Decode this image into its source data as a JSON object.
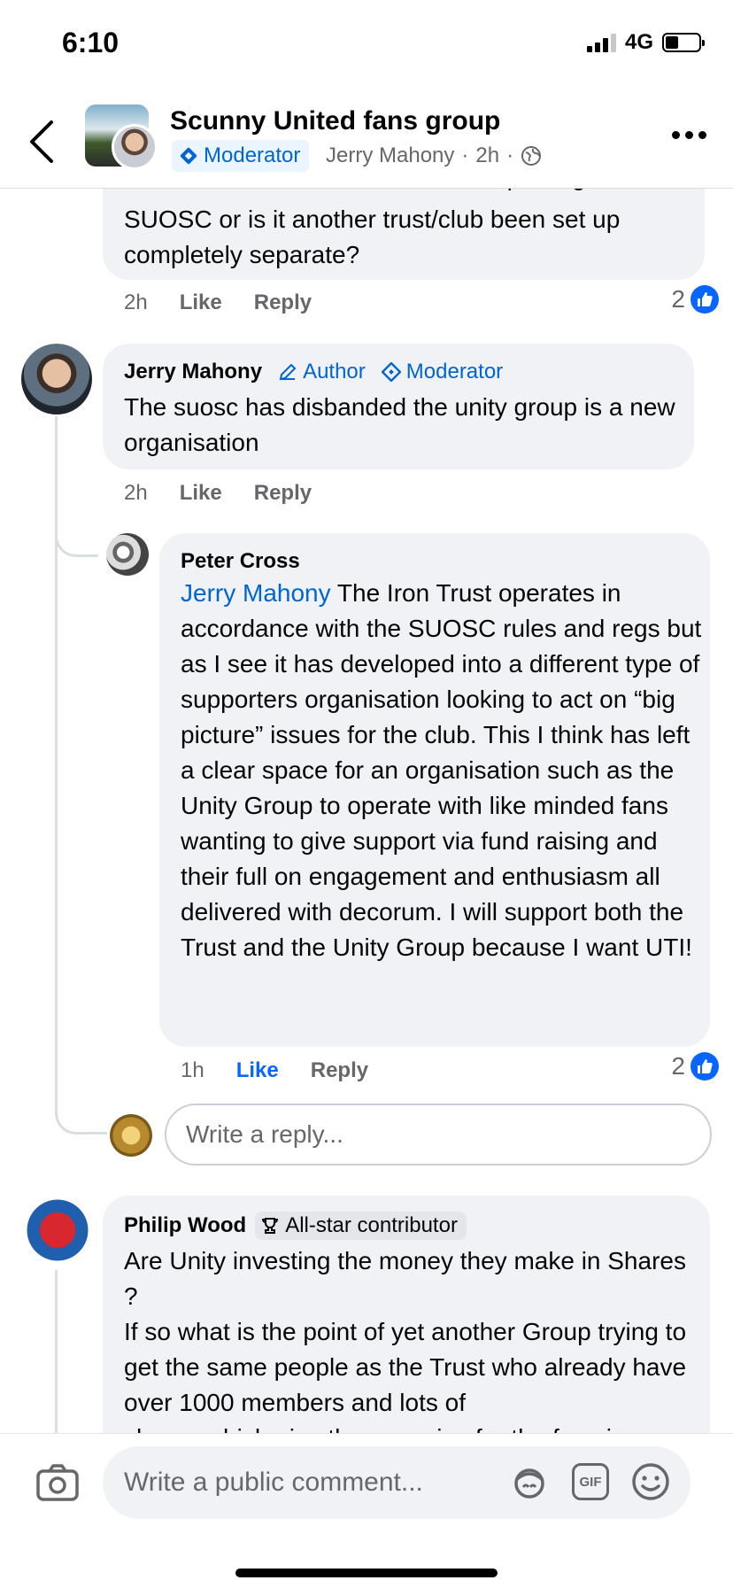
{
  "status": {
    "time": "6:10",
    "network": "4G"
  },
  "header": {
    "group_name": "Scunny United fans group",
    "badge": "Moderator",
    "author": "Jerry Mahony",
    "age": "2h",
    "separator": "·"
  },
  "comments": [
    {
      "text_partial": "the southern fans it states is this replacing the",
      "text": "SUOSC or is it another trust/club been set up completely separate?",
      "time": "2h",
      "like": "Like",
      "reply": "Reply",
      "reactions": "2"
    },
    {
      "name": "Jerry Mahony",
      "author_tag": "Author",
      "mod_tag": "Moderator",
      "text": "The suosc has disbanded the unity group is a new organisation",
      "time": "2h",
      "like": "Like",
      "reply": "Reply"
    },
    {
      "name": "Peter Cross",
      "mention": "Jerry Mahony",
      "text": " The Iron Trust operates in accordance with the SUOSC rules and regs but as I see it has developed into a different type of supporters organisation looking to act on “big picture” issues for the club. This I think has left a clear space for an organisation such as the Unity Group to operate with like minded fans wanting to give support via fund raising and their full on engagement and enthusiasm all delivered with decorum. I will support both the Trust and the Unity Group because I want UTI!",
      "time": "1h",
      "like": "Like",
      "reply": "Reply",
      "reactions": "2"
    },
    {
      "name": "Philip Wood",
      "contributor_tag": "All-star contributor",
      "text": "Are Unity investing the money they make in Shares ?\nIf so what is the point of yet another Group trying to get the same people as the Trust who already have over 1000 members and lots of",
      "text_partial": "shares which give them a voice for the fans in"
    }
  ],
  "reply_box": {
    "placeholder": "Write a reply..."
  },
  "composer": {
    "placeholder": "Write a public comment...",
    "gif": "GIF"
  },
  "colors": {
    "accent": "#0866ff",
    "bubble": "#f0f2f5",
    "muted": "#65676b"
  }
}
